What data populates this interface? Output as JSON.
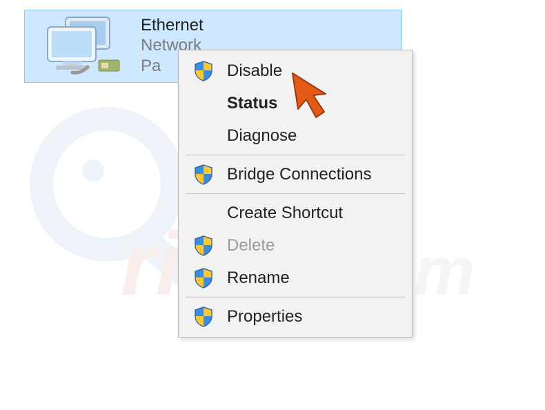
{
  "adapter": {
    "title": "Ethernet",
    "subtitle": "Network",
    "detail_truncated": "Pa"
  },
  "context_menu": {
    "items": [
      {
        "label": "Disable",
        "shield": true,
        "bold": false,
        "disabled": false
      },
      {
        "label": "Status",
        "shield": false,
        "bold": true,
        "disabled": false
      },
      {
        "label": "Diagnose",
        "shield": false,
        "bold": false,
        "disabled": false
      },
      {
        "sep": true
      },
      {
        "label": "Bridge Connections",
        "shield": true,
        "bold": false,
        "disabled": false
      },
      {
        "sep": true
      },
      {
        "label": "Create Shortcut",
        "shield": false,
        "bold": false,
        "disabled": false
      },
      {
        "label": "Delete",
        "shield": true,
        "bold": false,
        "disabled": true
      },
      {
        "label": "Rename",
        "shield": true,
        "bold": false,
        "disabled": false
      },
      {
        "sep": true
      },
      {
        "label": "Properties",
        "shield": true,
        "bold": false,
        "disabled": false
      }
    ]
  },
  "shield_colors": {
    "top_left": "#3a8de0",
    "top_right": "#ffc82e",
    "bot_left": "#ffc82e",
    "bot_right": "#3a8de0",
    "border": "#2d5f9e"
  },
  "cursor_color": "#e35a17",
  "watermark_text": "PCrisk.com"
}
